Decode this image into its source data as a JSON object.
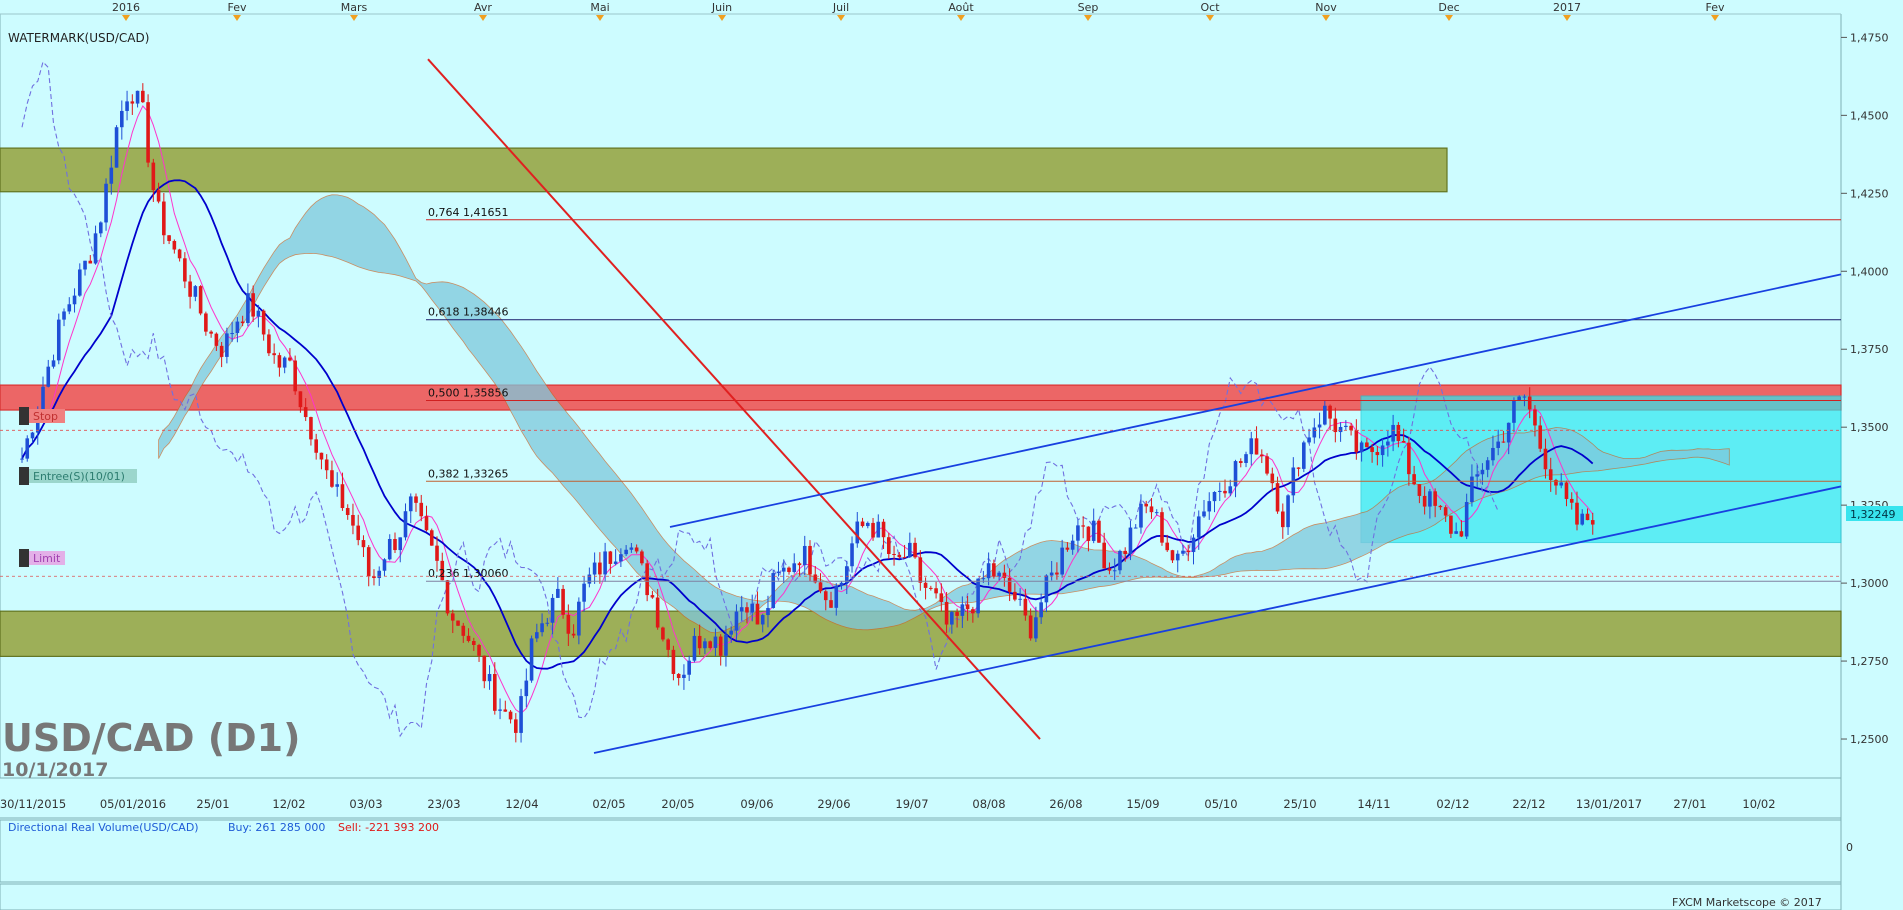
{
  "chart_title": "USD/CAD (D1)",
  "chart_date": "10/1/2017",
  "watermark_label": "WATERMARK(USD/CAD)",
  "copyright": "FXCM Marketscope © 2017",
  "current_price_label": "1,32249",
  "order_labels": {
    "stop": "Stop",
    "entry": "Entree(S)(10/01)",
    "limit": "Limit"
  },
  "indicator": {
    "name": "Directional Real Volume(USD/CAD)",
    "buy": "Buy: 261 285 000",
    "sell": "Sell: -221 393 200",
    "zero": "0"
  },
  "colors": {
    "background": "#cdfcff",
    "bull": "#1e4fd6",
    "bear": "#e01818",
    "tenkan": "#ff33cc",
    "kijun": "#0000cc",
    "chikou": "#7070e0",
    "zone_green": "#9aa94a",
    "zone_red": "#ef5a5a",
    "box_cyan": "#2ee8f0",
    "fib_line": "#1a1a6a",
    "trend_line": "#1840e0"
  },
  "chart_data": {
    "type": "candlestick",
    "symbol": "USD/CAD",
    "timeframe": "D1",
    "ylim": [
      1.2375,
      1.4825
    ],
    "y_ticks": [
      "1,4750",
      "1,4500",
      "1,4250",
      "1,4000",
      "1,3750",
      "1,3500",
      "1,3250",
      "1,3000",
      "1,2750",
      "1,2500"
    ],
    "top_axis_labels": [
      "2016",
      "Fev",
      "Mars",
      "Avr",
      "Mai",
      "Juin",
      "Juil",
      "Août",
      "Sep",
      "Oct",
      "Nov",
      "Dec",
      "2017",
      "Fev"
    ],
    "bottom_axis_labels": [
      "30/11/2015",
      "05/01/2016",
      "25/01",
      "12/02",
      "03/03",
      "23/03",
      "12/04",
      "02/05",
      "20/05",
      "09/06",
      "29/06",
      "19/07",
      "08/08",
      "26/08",
      "15/09",
      "05/10",
      "25/10",
      "14/11",
      "02/12",
      "22/12",
      "13/01/2017",
      "27/01",
      "10/02"
    ],
    "fibonacci": [
      {
        "label": "0,764 1,41651",
        "value": 1.41651
      },
      {
        "label": "0,618 1,38446",
        "value": 1.38446
      },
      {
        "label": "0,500 1,35856",
        "value": 1.35856
      },
      {
        "label": "0,382 1,33265",
        "value": 1.33265
      },
      {
        "label": "0,236 1,30060",
        "value": 1.3006
      }
    ],
    "zones": [
      {
        "name": "resistance-zone",
        "from": 1.4255,
        "to": 1.4395
      },
      {
        "name": "sell-zone",
        "from": 1.3555,
        "to": 1.3635
      },
      {
        "name": "support-zone",
        "from": 1.2765,
        "to": 1.291
      }
    ],
    "close_path": [
      1.34,
      1.355,
      1.37,
      1.385,
      1.395,
      1.405,
      1.42,
      1.445,
      1.46,
      1.45,
      1.42,
      1.41,
      1.4,
      1.39,
      1.38,
      1.375,
      1.385,
      1.39,
      1.38,
      1.37,
      1.37,
      1.355,
      1.345,
      1.33,
      1.325,
      1.315,
      1.3,
      1.31,
      1.315,
      1.325,
      1.315,
      1.305,
      1.29,
      1.285,
      1.275,
      1.265,
      1.258,
      1.255,
      1.28,
      1.29,
      1.295,
      1.285,
      1.3,
      1.305,
      1.31,
      1.315,
      1.305,
      1.295,
      1.28,
      1.27,
      1.28,
      1.285,
      1.28,
      1.29,
      1.295,
      1.285,
      1.3,
      1.305,
      1.31,
      1.305,
      1.295,
      1.3,
      1.315,
      1.32,
      1.315,
      1.305,
      1.31,
      1.3,
      1.295,
      1.285,
      1.29,
      1.295,
      1.305,
      1.3,
      1.295,
      1.285,
      1.295,
      1.305,
      1.315,
      1.32,
      1.315,
      1.305,
      1.31,
      1.32,
      1.325,
      1.315,
      1.305,
      1.315,
      1.325,
      1.33,
      1.335,
      1.34,
      1.345,
      1.335,
      1.32,
      1.34,
      1.35,
      1.355,
      1.35,
      1.345,
      1.34,
      1.345,
      1.35,
      1.34,
      1.33,
      1.325,
      1.32,
      1.315,
      1.33,
      1.34,
      1.345,
      1.355,
      1.36,
      1.345,
      1.335,
      1.325,
      1.318,
      1.3225
    ]
  }
}
